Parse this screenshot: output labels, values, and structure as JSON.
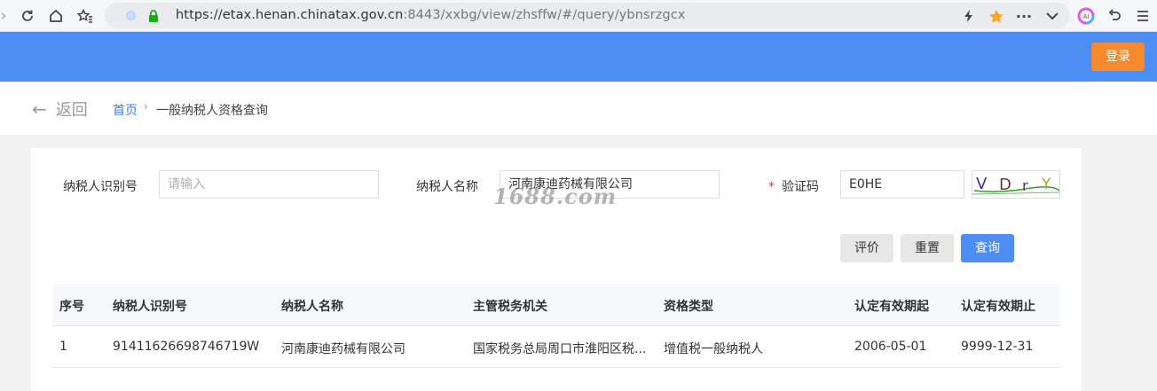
{
  "browser": {
    "url_main": "https://etax.henan.chinatax.gov.cn",
    "url_rest": ":8443/xxbg/view/zhsffw/#/query/ybnsrzgcx",
    "icons": [
      "refresh-icon",
      "home-icon",
      "bookmark-star-icon",
      "shield-icon",
      "lock-icon",
      "lightning-icon",
      "favorite-star-icon",
      "more-icon",
      "chevron-down-icon",
      "ai-icon",
      "undo-icon",
      "menu-icon"
    ],
    "colors": {
      "star": "#f5a623",
      "lock": "#1aad19"
    }
  },
  "header": {
    "login_label": "登录",
    "bg_color": "#4d8ef5",
    "login_color": "#f5892c"
  },
  "breadcrumb": {
    "back_label": "返回",
    "home": "首页",
    "separator": "›",
    "current": "一般纳税人资格查询"
  },
  "form": {
    "taxpayer_id_label": "纳税人识别号",
    "taxpayer_id_placeholder": "请输入",
    "taxpayer_name_label": "纳税人名称",
    "taxpayer_name_value": "河南康迪药械有限公司",
    "captcha_required_mark": "*",
    "captcha_label": "验证码",
    "captcha_value": "E0HE",
    "captcha_image_text": "VDrY"
  },
  "buttons": {
    "evaluate": "评价",
    "reset": "重置",
    "query": "查询"
  },
  "table": {
    "headers": [
      "序号",
      "纳税人识别号",
      "纳税人名称",
      "主管税务机关",
      "资格类型",
      "认定有效期起",
      "认定有效期止"
    ],
    "rows": [
      [
        "1",
        "91411626698746719W",
        "河南康迪药械有限公司",
        "国家税务总局周口市淮阳区税...",
        "增值税一般纳税人",
        "2006-05-01",
        "9999-12-31"
      ]
    ]
  },
  "watermark": "1688.com"
}
